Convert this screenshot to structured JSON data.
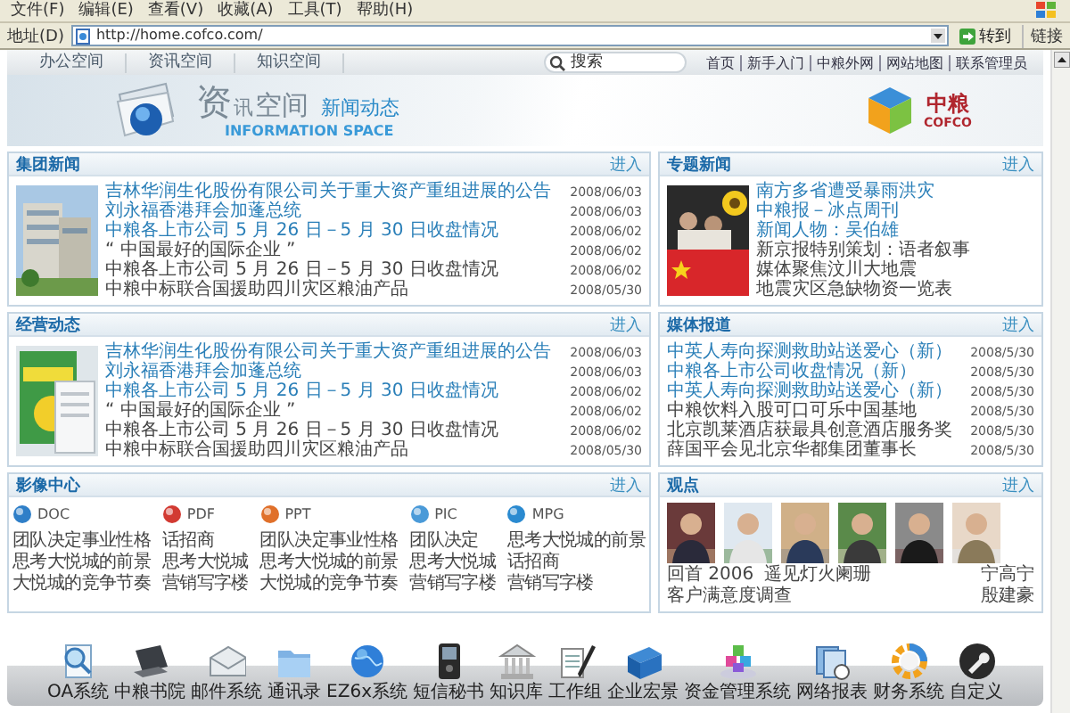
{
  "menu": [
    "文件(F)",
    "编辑(E)",
    "查看(V)",
    "收藏(A)",
    "工具(T)",
    "帮助(H)"
  ],
  "address_bar": {
    "label": "地址(D)",
    "url": "http://home.cofco.com/",
    "go": "转到",
    "links": "链接"
  },
  "nav": {
    "tabs": [
      "办公空间",
      "资讯空间",
      "知识空间"
    ],
    "search": {
      "placeholder": "搜索"
    },
    "links": [
      "首页",
      "新手入门",
      "中粮外网",
      "网站地图",
      "联系管理员"
    ]
  },
  "header": {
    "title_big": "资",
    "title_small": "讯",
    "title_rest": "空间",
    "subtitle": "新闻动态",
    "english": "INFORMATION SPACE",
    "logo_cn": "中粮",
    "logo_en": "COFCO"
  },
  "panels": [
    {
      "kind": "news",
      "title": "集团新闻",
      "more": "进入",
      "photo": {
        "kind": "picture"
      },
      "items": [
        {
          "title": "吉林华润生化股份有限公司关于重大资产重组进展的公告",
          "date": "2008/06/03",
          "highlighted": true
        },
        {
          "title": "刘永福香港拜会加蓬总统",
          "date": "2008/06/03",
          "highlighted": true
        },
        {
          "title": "中粮各上市公司 5 月 26 日－5 月 30 日收盘情况",
          "date": "2008/06/02",
          "highlighted": true
        },
        {
          "title": "“ 中国最好的国际企业 ”",
          "date": "2008/06/02",
          "highlighted": false
        },
        {
          "title": "中粮各上市公司 5 月 26 日－5 月 30 日收盘情况",
          "date": "2008/06/02",
          "highlighted": false
        },
        {
          "title": "中粮中标联合国援助四川灾区粮油产品",
          "date": "2008/05/30",
          "highlighted": false
        }
      ]
    },
    {
      "kind": "news",
      "title": "专题新闻",
      "more": "进入",
      "photo": {
        "kind": "picture"
      },
      "items": [
        {
          "title": "南方多省遭受暴雨洪灾",
          "highlighted": true
        },
        {
          "title": "中粮报－冰点周刊",
          "highlighted": true
        },
        {
          "title": "新闻人物：吴伯雄",
          "highlighted": true
        },
        {
          "title": "新京报特别策划：语者叙事",
          "highlighted": false
        },
        {
          "title": "媒体聚焦汶川大地震",
          "highlighted": false
        },
        {
          "title": "地震灾区急缺物资一览表",
          "highlighted": false
        }
      ]
    },
    {
      "kind": "news",
      "title": "经营动态",
      "more": "进入",
      "photo": {
        "kind": "picture"
      },
      "items": [
        {
          "title": "吉林华润生化股份有限公司关于重大资产重组进展的公告",
          "date": "2008/06/03",
          "highlighted": true
        },
        {
          "title": "刘永福香港拜会加蓬总统",
          "date": "2008/06/03",
          "highlighted": true
        },
        {
          "title": "中粮各上市公司 5 月 26 日－5 月 30 日收盘情况",
          "date": "2008/06/02",
          "highlighted": true
        },
        {
          "title": "“ 中国最好的国际企业 ”",
          "date": "2008/06/02",
          "highlighted": false
        },
        {
          "title": "中粮各上市公司 5 月 26 日－5 月 30 日收盘情况",
          "date": "2008/06/02",
          "highlighted": false
        },
        {
          "title": "中粮中标联合国援助四川灾区粮油产品",
          "date": "2008/05/30",
          "highlighted": false
        }
      ]
    },
    {
      "kind": "news",
      "title": "媒体报道",
      "more": "进入",
      "items": [
        {
          "title": "中英人寿向探测救助站送爱心（新）",
          "date": "2008/5/30",
          "highlighted": true
        },
        {
          "title": "中粮各上市公司收盘情况（新）",
          "date": "2008/5/30",
          "highlighted": true
        },
        {
          "title": "中英人寿向探测救助站送爱心（新）",
          "date": "2008/5/30",
          "highlighted": true
        },
        {
          "title": "中粮饮料入股可口可乐中国基地",
          "date": "2008/5/30",
          "highlighted": false
        },
        {
          "title": "北京凯莱酒店获最具创意酒店服务奖",
          "date": "2008/5/30",
          "highlighted": false
        },
        {
          "title": "薛国平会见北京华都集团董事长",
          "date": "2008/5/30",
          "highlighted": false
        }
      ]
    },
    {
      "kind": "media",
      "title": "影像中心",
      "more": "进入",
      "files": [
        {
          "type": "DOC",
          "color": "#2f7fc8",
          "links": [
            "团队决定事业性格",
            "思考大悦城的前景",
            "大悦城的竞争节奏"
          ]
        },
        {
          "type": "PDF",
          "color": "#d23a32",
          "links": [
            "话招商",
            "思考大悦城",
            "营销写字楼"
          ]
        },
        {
          "type": "PPT",
          "color": "#e0702a",
          "links": [
            "团队决定事业性格",
            "思考大悦城的前景",
            "大悦城的竞争节奏"
          ]
        },
        {
          "type": "PIC",
          "color": "#4a9ad8",
          "links": [
            "团队决定",
            "思考大悦城",
            "营销写字楼"
          ]
        },
        {
          "type": "MPG",
          "color": "#2a8ad0",
          "links": [
            "思考大悦城的前景",
            "话招商",
            "营销写字楼"
          ]
        }
      ]
    },
    {
      "kind": "viewpoints",
      "title": "观点",
      "more": "进入",
      "photos": [
        {
          "kind": "picture"
        },
        {
          "kind": "picture"
        },
        {
          "kind": "picture"
        },
        {
          "kind": "picture"
        },
        {
          "kind": "picture"
        },
        {
          "kind": "picture"
        }
      ],
      "captions": [
        [
          "回首 2006",
          "遥见灯火阑珊",
          "宁高宁"
        ],
        [
          "客户满意度调查",
          "殷建豪"
        ]
      ]
    }
  ],
  "dock": [
    "OA系统",
    "中粮书院",
    "邮件系统",
    "通讯录",
    "EZ6x系统",
    "短信秘书",
    "知识库",
    "工作组",
    "企业宏景",
    "资金管理系统",
    "网络报表",
    "财务系统",
    "自定义"
  ]
}
